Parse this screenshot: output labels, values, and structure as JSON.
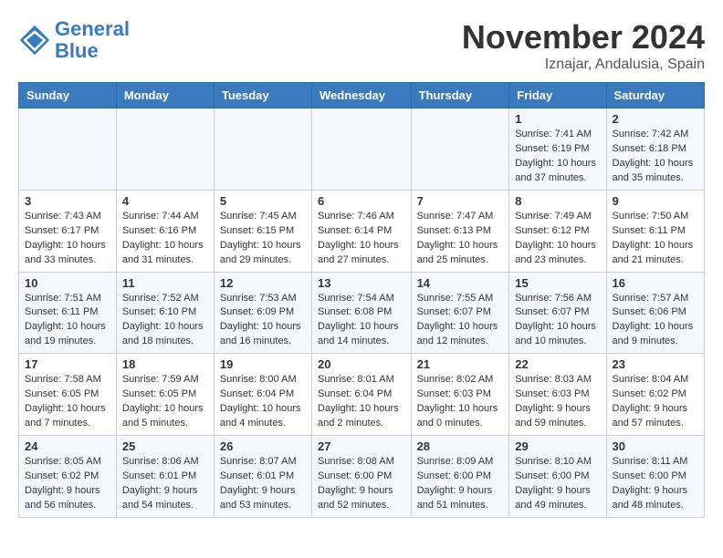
{
  "header": {
    "logo_line1": "General",
    "logo_line2": "Blue",
    "month": "November 2024",
    "location": "Iznajar, Andalusia, Spain"
  },
  "weekdays": [
    "Sunday",
    "Monday",
    "Tuesday",
    "Wednesday",
    "Thursday",
    "Friday",
    "Saturday"
  ],
  "rows": [
    [
      {
        "day": "",
        "info": ""
      },
      {
        "day": "",
        "info": ""
      },
      {
        "day": "",
        "info": ""
      },
      {
        "day": "",
        "info": ""
      },
      {
        "day": "",
        "info": ""
      },
      {
        "day": "1",
        "info": "Sunrise: 7:41 AM\nSunset: 6:19 PM\nDaylight: 10 hours\nand 37 minutes."
      },
      {
        "day": "2",
        "info": "Sunrise: 7:42 AM\nSunset: 6:18 PM\nDaylight: 10 hours\nand 35 minutes."
      }
    ],
    [
      {
        "day": "3",
        "info": "Sunrise: 7:43 AM\nSunset: 6:17 PM\nDaylight: 10 hours\nand 33 minutes."
      },
      {
        "day": "4",
        "info": "Sunrise: 7:44 AM\nSunset: 6:16 PM\nDaylight: 10 hours\nand 31 minutes."
      },
      {
        "day": "5",
        "info": "Sunrise: 7:45 AM\nSunset: 6:15 PM\nDaylight: 10 hours\nand 29 minutes."
      },
      {
        "day": "6",
        "info": "Sunrise: 7:46 AM\nSunset: 6:14 PM\nDaylight: 10 hours\nand 27 minutes."
      },
      {
        "day": "7",
        "info": "Sunrise: 7:47 AM\nSunset: 6:13 PM\nDaylight: 10 hours\nand 25 minutes."
      },
      {
        "day": "8",
        "info": "Sunrise: 7:49 AM\nSunset: 6:12 PM\nDaylight: 10 hours\nand 23 minutes."
      },
      {
        "day": "9",
        "info": "Sunrise: 7:50 AM\nSunset: 6:11 PM\nDaylight: 10 hours\nand 21 minutes."
      }
    ],
    [
      {
        "day": "10",
        "info": "Sunrise: 7:51 AM\nSunset: 6:11 PM\nDaylight: 10 hours\nand 19 minutes."
      },
      {
        "day": "11",
        "info": "Sunrise: 7:52 AM\nSunset: 6:10 PM\nDaylight: 10 hours\nand 18 minutes."
      },
      {
        "day": "12",
        "info": "Sunrise: 7:53 AM\nSunset: 6:09 PM\nDaylight: 10 hours\nand 16 minutes."
      },
      {
        "day": "13",
        "info": "Sunrise: 7:54 AM\nSunset: 6:08 PM\nDaylight: 10 hours\nand 14 minutes."
      },
      {
        "day": "14",
        "info": "Sunrise: 7:55 AM\nSunset: 6:07 PM\nDaylight: 10 hours\nand 12 minutes."
      },
      {
        "day": "15",
        "info": "Sunrise: 7:56 AM\nSunset: 6:07 PM\nDaylight: 10 hours\nand 10 minutes."
      },
      {
        "day": "16",
        "info": "Sunrise: 7:57 AM\nSunset: 6:06 PM\nDaylight: 10 hours\nand 9 minutes."
      }
    ],
    [
      {
        "day": "17",
        "info": "Sunrise: 7:58 AM\nSunset: 6:05 PM\nDaylight: 10 hours\nand 7 minutes."
      },
      {
        "day": "18",
        "info": "Sunrise: 7:59 AM\nSunset: 6:05 PM\nDaylight: 10 hours\nand 5 minutes."
      },
      {
        "day": "19",
        "info": "Sunrise: 8:00 AM\nSunset: 6:04 PM\nDaylight: 10 hours\nand 4 minutes."
      },
      {
        "day": "20",
        "info": "Sunrise: 8:01 AM\nSunset: 6:04 PM\nDaylight: 10 hours\nand 2 minutes."
      },
      {
        "day": "21",
        "info": "Sunrise: 8:02 AM\nSunset: 6:03 PM\nDaylight: 10 hours\nand 0 minutes."
      },
      {
        "day": "22",
        "info": "Sunrise: 8:03 AM\nSunset: 6:03 PM\nDaylight: 9 hours\nand 59 minutes."
      },
      {
        "day": "23",
        "info": "Sunrise: 8:04 AM\nSunset: 6:02 PM\nDaylight: 9 hours\nand 57 minutes."
      }
    ],
    [
      {
        "day": "24",
        "info": "Sunrise: 8:05 AM\nSunset: 6:02 PM\nDaylight: 9 hours\nand 56 minutes."
      },
      {
        "day": "25",
        "info": "Sunrise: 8:06 AM\nSunset: 6:01 PM\nDaylight: 9 hours\nand 54 minutes."
      },
      {
        "day": "26",
        "info": "Sunrise: 8:07 AM\nSunset: 6:01 PM\nDaylight: 9 hours\nand 53 minutes."
      },
      {
        "day": "27",
        "info": "Sunrise: 8:08 AM\nSunset: 6:00 PM\nDaylight: 9 hours\nand 52 minutes."
      },
      {
        "day": "28",
        "info": "Sunrise: 8:09 AM\nSunset: 6:00 PM\nDaylight: 9 hours\nand 51 minutes."
      },
      {
        "day": "29",
        "info": "Sunrise: 8:10 AM\nSunset: 6:00 PM\nDaylight: 9 hours\nand 49 minutes."
      },
      {
        "day": "30",
        "info": "Sunrise: 8:11 AM\nSunset: 6:00 PM\nDaylight: 9 hours\nand 48 minutes."
      }
    ]
  ]
}
